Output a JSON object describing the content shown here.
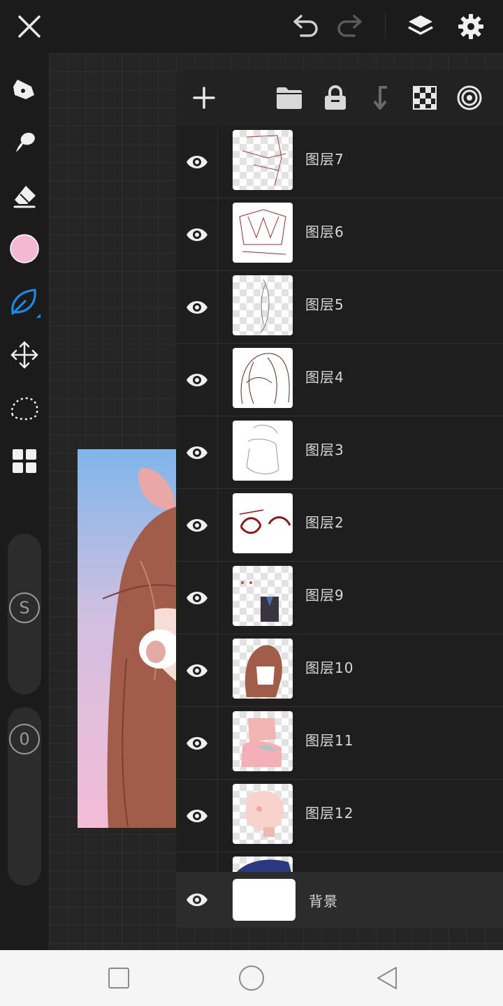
{
  "topbar": {
    "icons": [
      "close-icon",
      "undo-icon",
      "redo-icon",
      "layers-icon",
      "gear-icon"
    ]
  },
  "toolbar": {
    "tools": [
      "pen-icon",
      "smudge-icon",
      "eraser-icon",
      "color-swatch",
      "brush-icon",
      "move-icon",
      "lasso-icon",
      "grid-menu-icon"
    ],
    "current_color": "#f4b8d4",
    "active_color": "#1e88e5",
    "size_slider_label": "S",
    "opacity_slider_label": "0"
  },
  "panel": {
    "actions": [
      "add-layer-icon",
      "folder-icon",
      "lock-icon",
      "merge-down-icon",
      "checker-icon",
      "blend-icon"
    ],
    "layers": [
      {
        "name": "图层7"
      },
      {
        "name": "图层6"
      },
      {
        "name": "图层5"
      },
      {
        "name": "图层4"
      },
      {
        "name": "图层3"
      },
      {
        "name": "图层2"
      },
      {
        "name": "图层9"
      },
      {
        "name": "图层10"
      },
      {
        "name": "图层11"
      },
      {
        "name": "图层12"
      }
    ],
    "background_layer": {
      "name": "背景"
    }
  },
  "navbar": {
    "icons": [
      "recents-icon",
      "home-icon",
      "back-icon"
    ]
  }
}
